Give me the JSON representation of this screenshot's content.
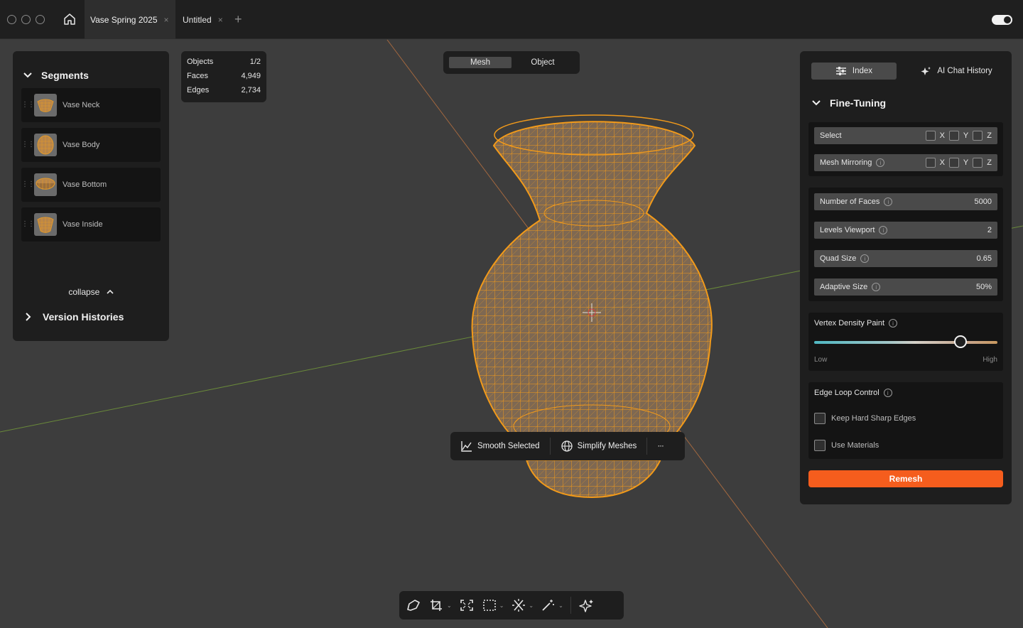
{
  "tabs": [
    {
      "label": "Vase Spring 2025",
      "active": true
    },
    {
      "label": "Untitled",
      "active": false
    }
  ],
  "tab_close_glyph": "×",
  "tab_add_glyph": "+",
  "segments": {
    "title": "Segments",
    "items": [
      {
        "label": "Vase Neck"
      },
      {
        "label": "Vase Body"
      },
      {
        "label": "Vase Bottom"
      },
      {
        "label": "Vase Inside"
      }
    ],
    "collapse_label": "collapse",
    "version_histories_label": "Version Histories"
  },
  "stats": [
    {
      "label": "Objects",
      "value": "1/2"
    },
    {
      "label": "Faces",
      "value": "4,949"
    },
    {
      "label": "Edges",
      "value": "2,734"
    }
  ],
  "mode": {
    "mesh_label": "Mesh",
    "object_label": "Object",
    "active": "mesh"
  },
  "actions": {
    "smooth_label": "Smooth Selected",
    "simplify_label": "Simplify Meshes",
    "more_label": "···"
  },
  "right_panel": {
    "index_tab": "Index",
    "ai_chat_tab": "AI Chat History",
    "fine_tuning_title": "Fine-Tuning",
    "select_label": "Select",
    "mesh_mirroring_label": "Mesh Mirroring",
    "axis_x": "X",
    "axis_y": "Y",
    "axis_z": "Z",
    "number_of_faces_label": "Number of Faces",
    "number_of_faces_value": "5000",
    "levels_viewport_label": "Levels Viewport",
    "levels_viewport_value": "2",
    "quad_size_label": "Quad Size",
    "quad_size_value": "0.65",
    "adaptive_size_label": "Adaptive Size",
    "adaptive_size_value": "50%",
    "vertex_density_label": "Vertex Density Paint",
    "vertex_density_level": 0.8,
    "low_label": "Low",
    "high_label": "High",
    "edge_loop_label": "Edge Loop Control",
    "keep_hard_edges_label": "Keep Hard Sharp Edges",
    "use_materials_label": "Use Materials",
    "remesh_label": "Remesh"
  },
  "colors": {
    "accent_orange": "#f55d1d",
    "mesh_wire": "#f29a1a",
    "x_axis_line": "#a3683f",
    "y_axis_line": "#6a8a3a"
  }
}
